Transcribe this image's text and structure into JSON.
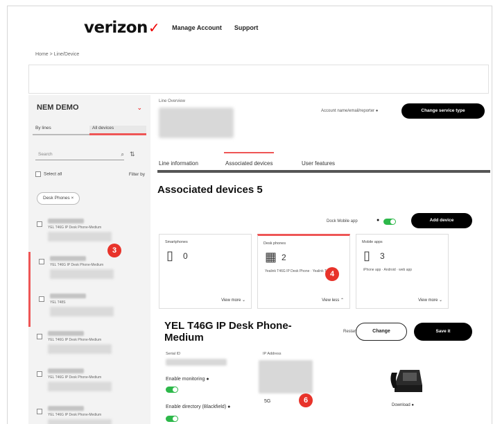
{
  "header": {
    "logo": "verizon",
    "logo_mark": "✓",
    "nav": [
      "Manage Account",
      "Support"
    ]
  },
  "breadcrumb": "Home > Line/Device",
  "sidebar": {
    "account": "NEM DEMO",
    "tabs": [
      "By lines",
      "All devices"
    ],
    "search_placeholder": "Search",
    "select_all": "Select all",
    "filter_by": "Filter by",
    "chip": "Desk Phones ×",
    "items": [
      {
        "model": "YEL T46G IP Desk Phone-Medium"
      },
      {
        "model": "YEL T46G IP Desk Phone-Medium"
      },
      {
        "model": "YEL T48S"
      },
      {
        "model": "YEL T46G IP Desk Phone-Medium"
      },
      {
        "model": "YEL T46G IP Desk Phone-Medium"
      },
      {
        "model": "YEL T46G IP Desk Phone-Medium"
      }
    ]
  },
  "main": {
    "line_label": "Line Overview",
    "account_pref": "Account name/email/reporter",
    "change_btn": "Change service type",
    "tabs": [
      "Line information",
      "Associated devices",
      "User features"
    ],
    "section_title": "Associated devices 5",
    "dock_label": "Dock Mobile app",
    "add_btn": "Add device",
    "cards": [
      {
        "title": "Smartphones",
        "icon": "▯",
        "count": "0",
        "desc": "",
        "more": "View more ⌄"
      },
      {
        "title": "Desk phones",
        "icon": "▦",
        "count": "2",
        "desc": "Yealink T46G IP Desk Phone · Yealink T48S",
        "more": "View less ⌃"
      },
      {
        "title": "Mobile apps",
        "icon": "▯",
        "count": "3",
        "desc": "iPhone app · Android · web app",
        "more": "View more ⌄"
      }
    ],
    "device": {
      "title": "YEL T46G IP Desk Phone-Medium",
      "reset": "Restart",
      "change_btn": "Change",
      "save_btn": "Save it",
      "serial_label": "Serial ID",
      "ip_label": "IP Address",
      "monitoring_label": "Enable monitoring",
      "directory_label": "Enable directory (Blackfield)",
      "small_text": "5G",
      "download": "Download"
    }
  },
  "badges": [
    "3",
    "4",
    "6"
  ]
}
